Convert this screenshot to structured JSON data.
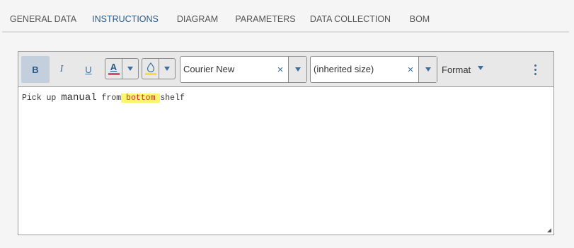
{
  "tabs": [
    {
      "label": "GENERAL DATA"
    },
    {
      "label": "INSTRUCTIONS"
    },
    {
      "label": "DIAGRAM"
    },
    {
      "label": "PARAMETERS"
    },
    {
      "label": "DATA COLLECTION"
    },
    {
      "label": "BOM"
    }
  ],
  "active_tab": "INSTRUCTIONS",
  "toolbar": {
    "bold_label": "B",
    "italic_label": "I",
    "underline_label": "U",
    "font_color_label": "A",
    "font_family": "Courier New",
    "font_size": "(inherited size)",
    "clear_glyph": "×",
    "format_label": "Format"
  },
  "content": {
    "part1": "Pick up ",
    "part2": "manual",
    "part3": " from",
    "part4": " bottom ",
    "part5": "shelf"
  },
  "colors": {
    "accent": "#1f5a86",
    "font_color": "#e04a6a",
    "highlight_color": "#f0e040",
    "highlighted_text": "#c0303a"
  }
}
